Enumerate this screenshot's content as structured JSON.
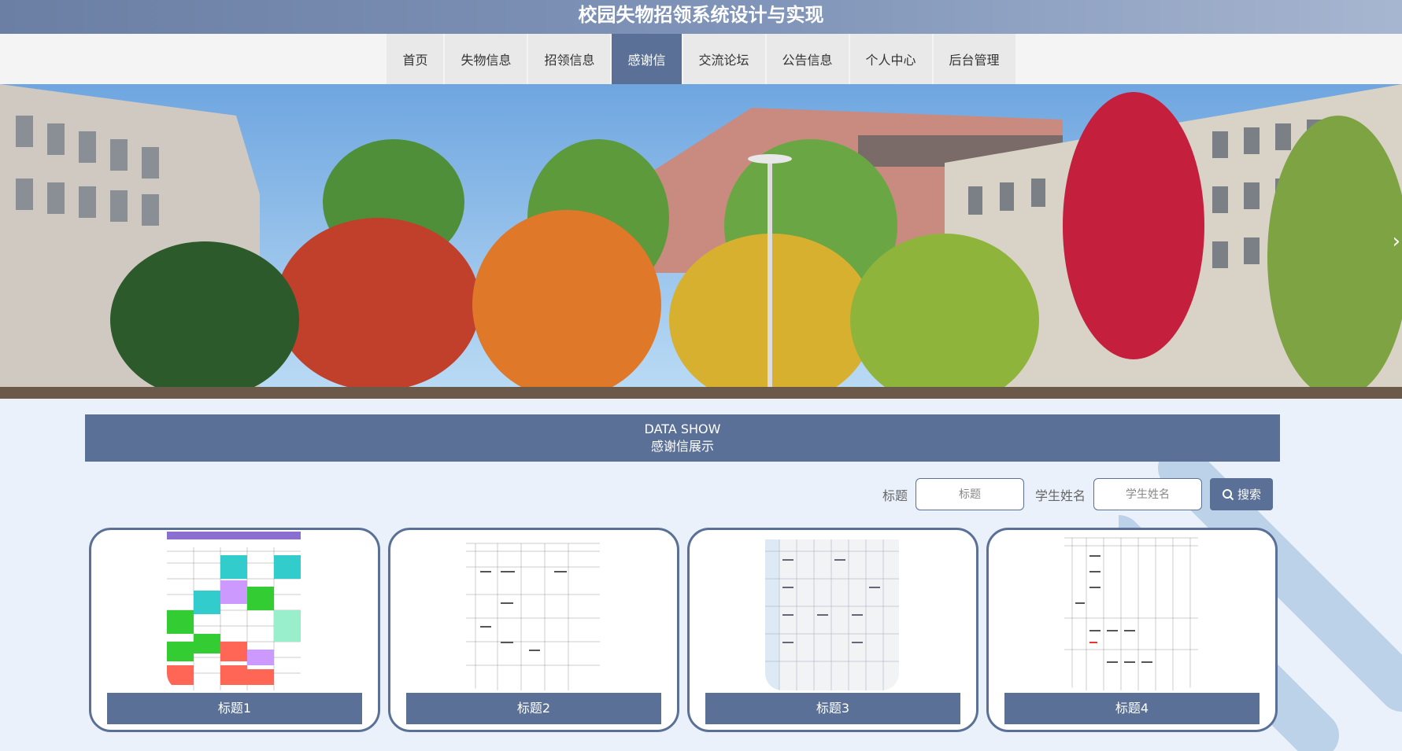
{
  "header": {
    "title": "校园失物招领系统设计与实现"
  },
  "nav": {
    "items": [
      {
        "label": "首页",
        "active": false
      },
      {
        "label": "失物信息",
        "active": false
      },
      {
        "label": "招领信息",
        "active": false
      },
      {
        "label": "感谢信",
        "active": true
      },
      {
        "label": "交流论坛",
        "active": false
      },
      {
        "label": "公告信息",
        "active": false
      },
      {
        "label": "个人中心",
        "active": false
      },
      {
        "label": "后台管理",
        "active": false
      }
    ]
  },
  "banner": {
    "next_icon": "chevron-right-icon",
    "next_glyph": "›"
  },
  "section": {
    "title_en": "DATA SHOW",
    "title_cn": "感谢信展示"
  },
  "search": {
    "title_label": "标题",
    "title_placeholder": "标题",
    "name_label": "学生姓名",
    "name_placeholder": "学生姓名",
    "button_label": "搜索",
    "button_icon": "search-icon"
  },
  "cards": [
    {
      "title": "标题1"
    },
    {
      "title": "标题2"
    },
    {
      "title": "标题3"
    },
    {
      "title": "标题4"
    }
  ],
  "colors": {
    "primary": "#5a7096",
    "page_bg": "#eaf1fb",
    "nav_bg": "#f4f4f4"
  }
}
